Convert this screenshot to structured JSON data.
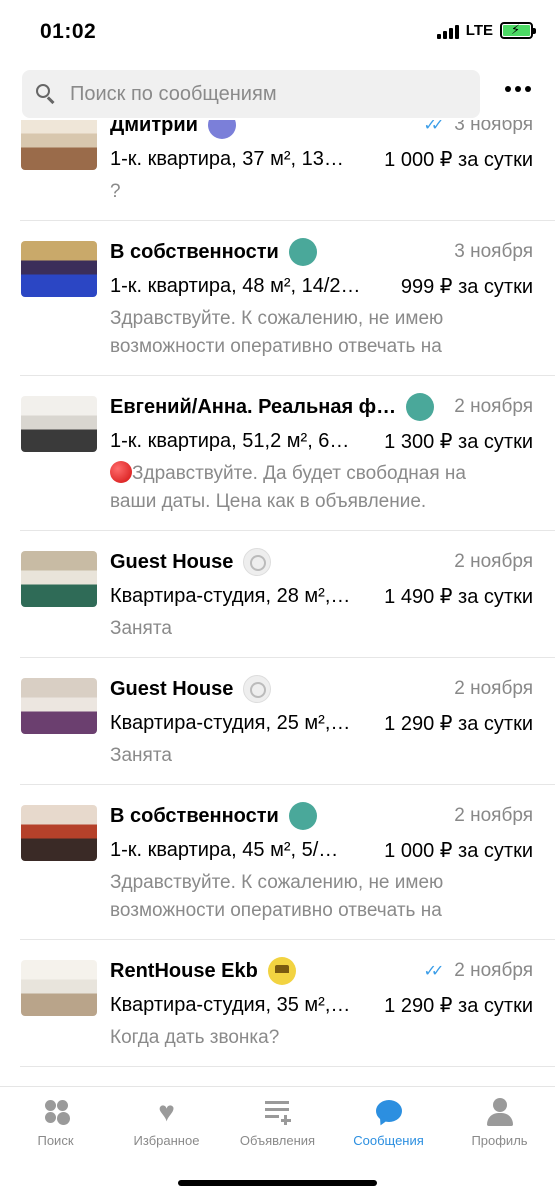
{
  "status_bar": {
    "time": "01:02",
    "network": "LTE"
  },
  "search": {
    "placeholder": "Поиск по сообщениям"
  },
  "conversations": [
    {
      "name": "Дмитрий",
      "badge": "purple",
      "date": "3 ноября",
      "read_checks": true,
      "listing": "1-к. квартира, 37 м², 13…",
      "price": "1 000 ₽ за сутки",
      "message": "?",
      "thumb_palette": [
        "#d8c7ae",
        "#9a6b4a",
        "#efe6d8"
      ]
    },
    {
      "name": "В собственности",
      "badge": "teal",
      "date": "3 ноября",
      "read_checks": false,
      "listing": "1-к. квартира, 48 м², 14/2…",
      "price": "999 ₽ за сутки",
      "message": "Здравствуйте. К сожалению, не имею возможности оперативно отвечать на",
      "thumb_palette": [
        "#3b2e5a",
        "#2b46c4",
        "#c9a96a"
      ]
    },
    {
      "name": "Евгений/Анна. Реальная ф…",
      "badge": "teal",
      "date": "2 ноября",
      "read_checks": false,
      "listing": "1-к. квартира, 51,2 м², 6…",
      "price": "1 300 ₽ за сутки",
      "message": "Здравствуйте. Да будет свободная на ваши даты. Цена как в объявление.",
      "red_dot": true,
      "thumb_palette": [
        "#d9d6d0",
        "#3a3a3a",
        "#f2f0ec"
      ]
    },
    {
      "name": "Guest House",
      "badge": "gray",
      "date": "2 ноября",
      "read_checks": false,
      "listing": "Квартира-студия, 28 м²,…",
      "price": "1 490 ₽ за сутки",
      "message": "Занята",
      "thumb_palette": [
        "#e9e4da",
        "#2f6b57",
        "#c8bba4"
      ]
    },
    {
      "name": "Guest House",
      "badge": "gray",
      "date": "2 ноября",
      "read_checks": false,
      "listing": "Квартира-студия, 25 м²,…",
      "price": "1 290 ₽ за сутки",
      "message": "Занята",
      "thumb_palette": [
        "#ece6e0",
        "#6b3f6f",
        "#d9cfc4"
      ]
    },
    {
      "name": "В собственности",
      "badge": "teal",
      "date": "2 ноября",
      "read_checks": false,
      "listing": "1-к. квартира, 45 м², 5/…",
      "price": "1 000 ₽ за сутки",
      "message": "Здравствуйте. К сожалению, не имею возможности оперативно отвечать на",
      "thumb_palette": [
        "#b5412a",
        "#3a2a26",
        "#e7d9cc"
      ]
    },
    {
      "name": "RentHouse Ekb",
      "badge": "yellow",
      "date": "2 ноября",
      "read_checks": true,
      "listing": "Квартира-студия, 35 м²,…",
      "price": "1 290 ₽ за сутки",
      "message": "Когда дать звонка?",
      "thumb_palette": [
        "#e8e4dc",
        "#b9a48a",
        "#f5f2ec"
      ]
    }
  ],
  "tab_bar": {
    "tabs": [
      {
        "label": "Поиск",
        "icon": "search-dots-icon",
        "active": false
      },
      {
        "label": "Избранное",
        "icon": "heart-icon",
        "active": false
      },
      {
        "label": "Объявления",
        "icon": "ads-list-icon",
        "active": false
      },
      {
        "label": "Сообщения",
        "icon": "chat-bubble-icon",
        "active": true
      },
      {
        "label": "Профиль",
        "icon": "profile-icon",
        "active": false
      }
    ]
  },
  "colors": {
    "accent": "#2c8fe0",
    "secondary_text": "#8a8a8a",
    "badge_teal": "#4aa89a"
  }
}
